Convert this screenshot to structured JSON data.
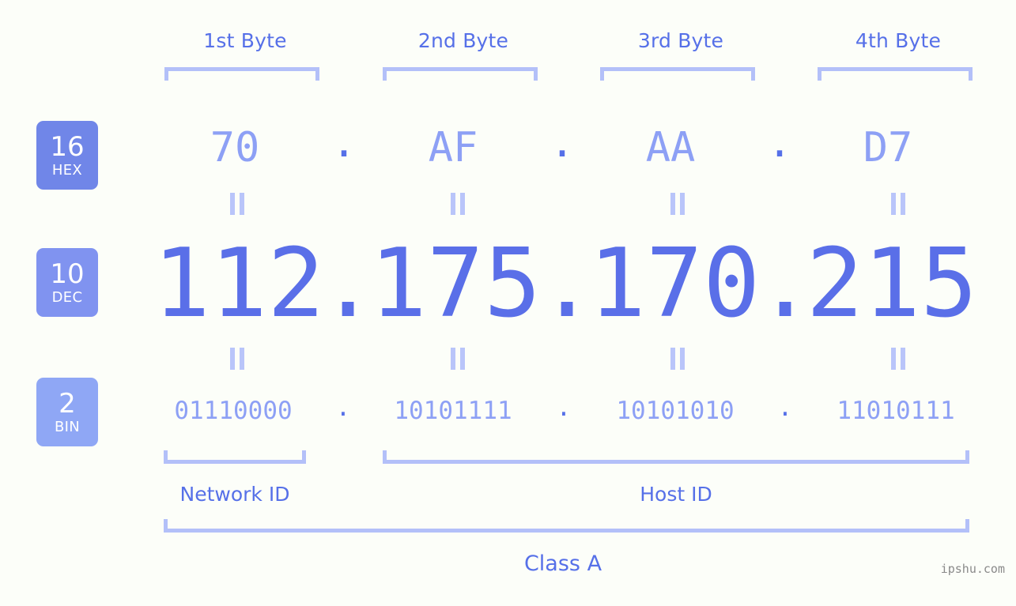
{
  "meta": {
    "background_color": "#fcfef9",
    "accent_color": "#5670e8",
    "light_accent_color": "#8da0f5",
    "bracket_color": "#b3c0f9",
    "watermark": "ipshu.com"
  },
  "byte_headers": [
    {
      "label": "1st Byte"
    },
    {
      "label": "2nd Byte"
    },
    {
      "label": "3rd Byte"
    },
    {
      "label": "4th Byte"
    }
  ],
  "bases": [
    {
      "num": "16",
      "abbr": "HEX",
      "color": "#7086e8"
    },
    {
      "num": "10",
      "abbr": "DEC",
      "color": "#8093f0"
    },
    {
      "num": "2",
      "abbr": "BIN",
      "color": "#8fa7f5"
    }
  ],
  "rows": {
    "hex": {
      "octets": [
        "70",
        "AF",
        "AA",
        "D7"
      ],
      "separator": "."
    },
    "dec": {
      "octets": [
        "112",
        "175",
        "170",
        "215"
      ],
      "separator": "."
    },
    "bin": {
      "octets": [
        "01110000",
        "10101111",
        "10101010",
        "11010111"
      ],
      "separator": "."
    }
  },
  "equality": {
    "symbol": "="
  },
  "sections": [
    {
      "label": "Network ID"
    },
    {
      "label": "Host ID"
    }
  ],
  "class": {
    "label": "Class A"
  },
  "ip_address": "112.175.170.215"
}
